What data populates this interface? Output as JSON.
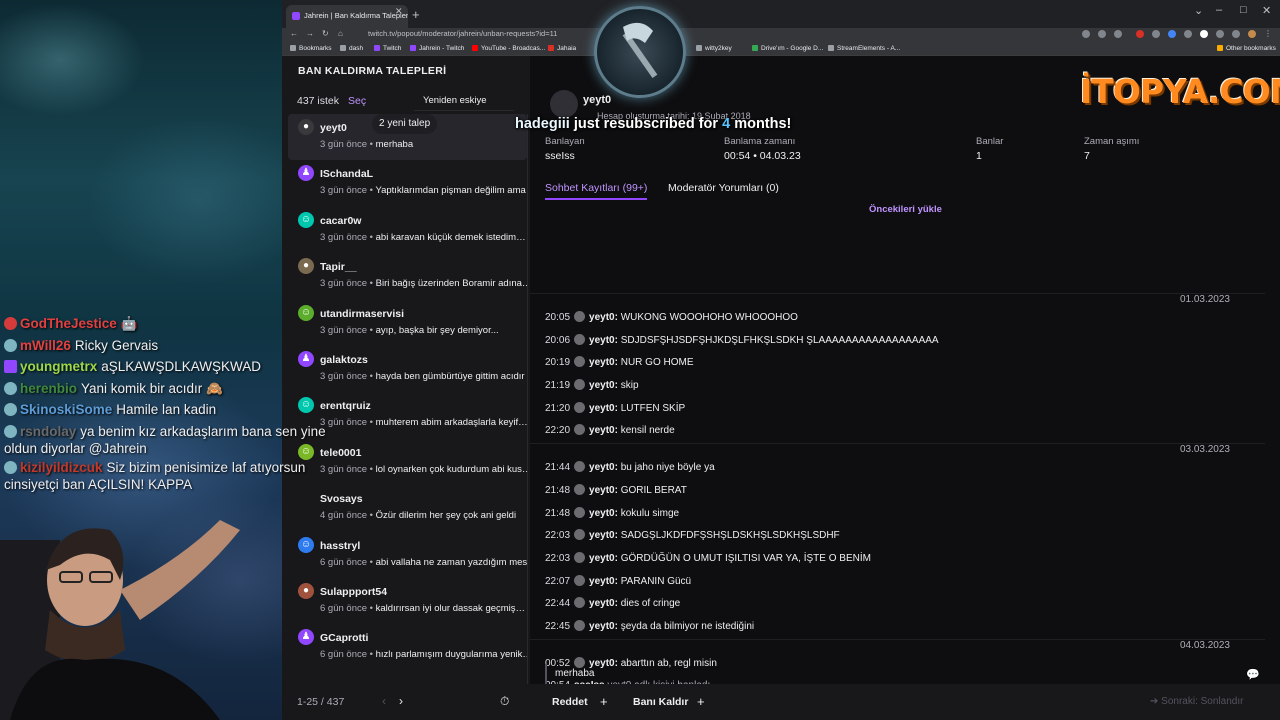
{
  "browser": {
    "tab_title": "Jahrein | Ban Kaldırma Talepleri",
    "tab_close": "✕",
    "new_tab": "+",
    "url": "twitch.tv/popout/moderator/jahrein/unban-requests?id=11",
    "bookmarks": [
      "Bookmarks",
      "dash",
      "Twitch",
      "Jahrein - Twitch",
      "YouTube - Broadcas...",
      "Jahaia",
      "witty2key",
      "Drive'ım - Google D...",
      "StreamElements - A...",
      "Other bookmarks"
    ]
  },
  "page": {
    "title": "BAN KALDIRMA TALEPLERİ",
    "request_count": "437 istek",
    "select_label": "Seç",
    "sort_value": "Yeniden eskiye",
    "new_requests_pill": "2 yeni talep",
    "pager_text": "1-25 / 437",
    "requests": [
      {
        "user": "yeyt0",
        "time": "3 gün önce",
        "message": "merhaba",
        "avatar_color": "#3a3a3d",
        "avatar_glyph": "●"
      },
      {
        "user": "ISchandaL",
        "time": "3 gün önce",
        "message": "Yaptıklarımdan pişman değilim ama…",
        "avatar_color": "#9147ff",
        "avatar_glyph": "♟"
      },
      {
        "user": "cacar0w",
        "time": "3 gün önce",
        "message": "abi karavan küçük demek istedim…",
        "avatar_color": "#00c8af",
        "avatar_glyph": "☺"
      },
      {
        "user": "Tapir__",
        "time": "3 gün önce",
        "message": "Biri bağış üzerinden Boramir adına…",
        "avatar_color": "#7a6a50",
        "avatar_glyph": "●"
      },
      {
        "user": "utandirmaservisi",
        "time": "3 gün önce",
        "message": "ayıp, başka bir şey demiyor...",
        "avatar_color": "#5cad2c",
        "avatar_glyph": "☺"
      },
      {
        "user": "galaktozs",
        "time": "3 gün önce",
        "message": "hayda ben gümbürtüye gittim acıdır",
        "avatar_color": "#9147ff",
        "avatar_glyph": "♟"
      },
      {
        "user": "erentqruiz",
        "time": "3 gün önce",
        "message": "muhterem abim arkadaşlarla keyif…",
        "avatar_color": "#00c8af",
        "avatar_glyph": "☺"
      },
      {
        "user": "tele0001",
        "time": "3 gün önce",
        "message": "lol oynarken çok kudurdum abi kus…",
        "avatar_color": "#7bb827",
        "avatar_glyph": "☺"
      },
      {
        "user": "Svosays",
        "time": "4 gün önce",
        "message": "Özür dilerim her şey çok ani geldi",
        "avatar_color": "#18181b",
        "avatar_glyph": ""
      },
      {
        "user": "hasstryl",
        "time": "6 gün önce",
        "message": "abi vallaha ne zaman yazdığım mes…",
        "avatar_color": "#2e7bf0",
        "avatar_glyph": "☺"
      },
      {
        "user": "Sulappport54",
        "time": "6 gün önce",
        "message": "kaldırırsan iyi olur dassak geçmiş…",
        "avatar_color": "#a0523d",
        "avatar_glyph": "●"
      },
      {
        "user": "GCaprotti",
        "time": "6 gün önce",
        "message": "hızlı parlamışım duygularıma yenik…",
        "avatar_color": "#9147ff",
        "avatar_glyph": "♟"
      }
    ]
  },
  "detail": {
    "username": "yeyt0",
    "created": "Hesap oluşturma tarihi: 19 Şubat 2018",
    "stats": [
      {
        "label": "Banlayan",
        "value": "sseIss"
      },
      {
        "label": "Banlama zamanı",
        "value": "00:54 • 04.03.23"
      },
      {
        "label": "Banlar",
        "value": "1"
      },
      {
        "label": "Zaman aşımı",
        "value": "7"
      }
    ],
    "tab_chatlogs": "Sohbet Kayıtları (99+)",
    "tab_modcomments": "Moderatör Yorumları (0)",
    "load_older": "Öncekileri yükle",
    "dates": [
      "01.03.2023",
      "03.03.2023",
      "04.03.2023"
    ],
    "chat_log": [
      {
        "time": "20:05",
        "user": "yeyt0:",
        "text": "WUKONG WOOOHOHO WHOOOHOO"
      },
      {
        "time": "20:06",
        "user": "yeyt0:",
        "text": "SDJDSFŞHJSDFŞHJKDŞLFHKŞLSDKH ŞLAAAAAAAAAAAAAAAAAA"
      },
      {
        "time": "20:19",
        "user": "yeyt0:",
        "text": "NUR GO HOME"
      },
      {
        "time": "21:19",
        "user": "yeyt0:",
        "text": "skip"
      },
      {
        "time": "21:20",
        "user": "yeyt0:",
        "text": "LUTFEN SKİP"
      },
      {
        "time": "22:20",
        "user": "yeyt0:",
        "text": "kensil nerde"
      },
      {
        "time": "21:44",
        "user": "yeyt0:",
        "text": "bu jaho niye böyle ya"
      },
      {
        "time": "21:48",
        "user": "yeyt0:",
        "text": "GORIL BERAT"
      },
      {
        "time": "21:48",
        "user": "yeyt0:",
        "text": "kokulu simge"
      },
      {
        "time": "22:03",
        "user": "yeyt0:",
        "text": "SADGŞLJKDFDFŞSHŞLDSKHŞLSDKHŞLSDHF"
      },
      {
        "time": "22:03",
        "user": "yeyt0:",
        "text": "GÖRDÜĞÜN O UMUT IŞILTISI VAR YA, İŞTE O BENİM"
      },
      {
        "time": "22:07",
        "user": "yeyt0:",
        "text": "PARANIN Gücü"
      },
      {
        "time": "22:44",
        "user": "yeyt0:",
        "text": "dies of cringe"
      },
      {
        "time": "22:45",
        "user": "yeyt0:",
        "text": "şeyda da bilmiyor ne istediğini"
      },
      {
        "time": "00:52",
        "user": "yeyt0:",
        "text": "abarttın ab, regl misin"
      }
    ],
    "system_line": {
      "time": "00:54",
      "actor": "sseIss",
      "text": "yeyt0 adlı kişiyi banladı."
    },
    "reply_text": "merhaba",
    "deny_label": "Reddet",
    "unban_label": "Banı Kaldır",
    "next_label": "Sonraki: Sonlandır"
  },
  "overlay_chat": [
    {
      "name": "GodTheJestice",
      "name_color": "#e34040",
      "text": "🤖",
      "badge": "red"
    },
    {
      "name": "mWill26",
      "name_color": "#e34040",
      "text": "Ricky Gervais",
      "badge": "blue"
    },
    {
      "name": "youngmetrx",
      "name_color": "#9bd84a",
      "text": "aŞLKAWŞDLKAWŞKWAD",
      "badge": "sq"
    },
    {
      "name": "herenbio",
      "name_color": "#3f8a3f",
      "text": "Yani komik bir acıdır 🙈",
      "badge": "blue"
    },
    {
      "name": "SkinoskiSome",
      "name_color": "#5c9bd6",
      "text": "Hamile lan kadin",
      "badge": "blue"
    },
    {
      "name": "rsndolay",
      "name_color": "#6a6a6a",
      "text": "ya benim kız arkadaşlarım bana sen yine oldun diyorlar @Jahrein",
      "badge": "blue"
    },
    {
      "name": "kizilyildizcuk",
      "name_color": "#c0392b",
      "text": "Siz bizim penisimize laf atıyorsun cinsiyetçi ban AÇILSIN! KAPPA",
      "badge": "blue"
    }
  ],
  "overlays": {
    "sub_alert_user": "hadegiii",
    "sub_alert_text_1": " just resubscribed for ",
    "sub_alert_count": "4",
    "sub_alert_text_2": " months!",
    "sponsor": "İTOPYA.COM"
  }
}
